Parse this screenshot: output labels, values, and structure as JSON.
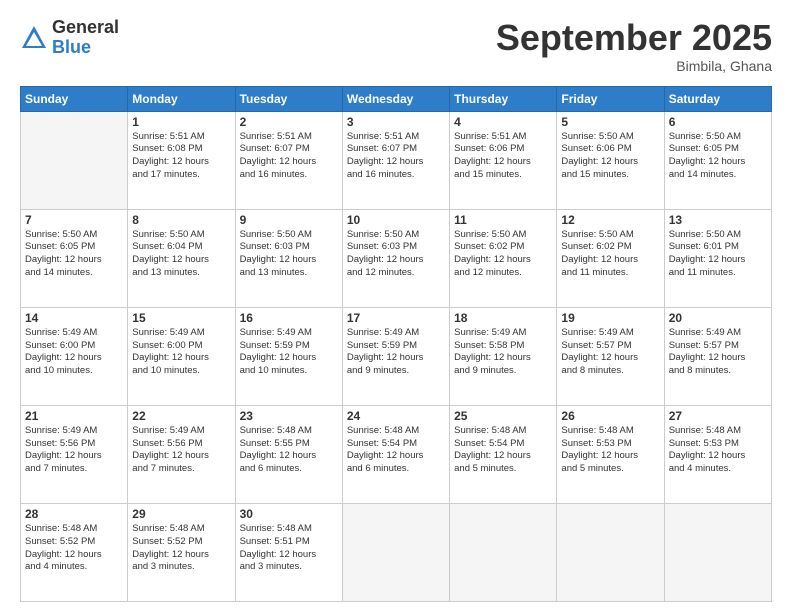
{
  "header": {
    "logo_general": "General",
    "logo_blue": "Blue",
    "month": "September 2025",
    "location": "Bimbila, Ghana"
  },
  "days_of_week": [
    "Sunday",
    "Monday",
    "Tuesday",
    "Wednesday",
    "Thursday",
    "Friday",
    "Saturday"
  ],
  "weeks": [
    [
      {
        "day": "",
        "info": ""
      },
      {
        "day": "1",
        "info": "Sunrise: 5:51 AM\nSunset: 6:08 PM\nDaylight: 12 hours\nand 17 minutes."
      },
      {
        "day": "2",
        "info": "Sunrise: 5:51 AM\nSunset: 6:07 PM\nDaylight: 12 hours\nand 16 minutes."
      },
      {
        "day": "3",
        "info": "Sunrise: 5:51 AM\nSunset: 6:07 PM\nDaylight: 12 hours\nand 16 minutes."
      },
      {
        "day": "4",
        "info": "Sunrise: 5:51 AM\nSunset: 6:06 PM\nDaylight: 12 hours\nand 15 minutes."
      },
      {
        "day": "5",
        "info": "Sunrise: 5:50 AM\nSunset: 6:06 PM\nDaylight: 12 hours\nand 15 minutes."
      },
      {
        "day": "6",
        "info": "Sunrise: 5:50 AM\nSunset: 6:05 PM\nDaylight: 12 hours\nand 14 minutes."
      }
    ],
    [
      {
        "day": "7",
        "info": "Sunrise: 5:50 AM\nSunset: 6:05 PM\nDaylight: 12 hours\nand 14 minutes."
      },
      {
        "day": "8",
        "info": "Sunrise: 5:50 AM\nSunset: 6:04 PM\nDaylight: 12 hours\nand 13 minutes."
      },
      {
        "day": "9",
        "info": "Sunrise: 5:50 AM\nSunset: 6:03 PM\nDaylight: 12 hours\nand 13 minutes."
      },
      {
        "day": "10",
        "info": "Sunrise: 5:50 AM\nSunset: 6:03 PM\nDaylight: 12 hours\nand 12 minutes."
      },
      {
        "day": "11",
        "info": "Sunrise: 5:50 AM\nSunset: 6:02 PM\nDaylight: 12 hours\nand 12 minutes."
      },
      {
        "day": "12",
        "info": "Sunrise: 5:50 AM\nSunset: 6:02 PM\nDaylight: 12 hours\nand 11 minutes."
      },
      {
        "day": "13",
        "info": "Sunrise: 5:50 AM\nSunset: 6:01 PM\nDaylight: 12 hours\nand 11 minutes."
      }
    ],
    [
      {
        "day": "14",
        "info": "Sunrise: 5:49 AM\nSunset: 6:00 PM\nDaylight: 12 hours\nand 10 minutes."
      },
      {
        "day": "15",
        "info": "Sunrise: 5:49 AM\nSunset: 6:00 PM\nDaylight: 12 hours\nand 10 minutes."
      },
      {
        "day": "16",
        "info": "Sunrise: 5:49 AM\nSunset: 5:59 PM\nDaylight: 12 hours\nand 10 minutes."
      },
      {
        "day": "17",
        "info": "Sunrise: 5:49 AM\nSunset: 5:59 PM\nDaylight: 12 hours\nand 9 minutes."
      },
      {
        "day": "18",
        "info": "Sunrise: 5:49 AM\nSunset: 5:58 PM\nDaylight: 12 hours\nand 9 minutes."
      },
      {
        "day": "19",
        "info": "Sunrise: 5:49 AM\nSunset: 5:57 PM\nDaylight: 12 hours\nand 8 minutes."
      },
      {
        "day": "20",
        "info": "Sunrise: 5:49 AM\nSunset: 5:57 PM\nDaylight: 12 hours\nand 8 minutes."
      }
    ],
    [
      {
        "day": "21",
        "info": "Sunrise: 5:49 AM\nSunset: 5:56 PM\nDaylight: 12 hours\nand 7 minutes."
      },
      {
        "day": "22",
        "info": "Sunrise: 5:49 AM\nSunset: 5:56 PM\nDaylight: 12 hours\nand 7 minutes."
      },
      {
        "day": "23",
        "info": "Sunrise: 5:48 AM\nSunset: 5:55 PM\nDaylight: 12 hours\nand 6 minutes."
      },
      {
        "day": "24",
        "info": "Sunrise: 5:48 AM\nSunset: 5:54 PM\nDaylight: 12 hours\nand 6 minutes."
      },
      {
        "day": "25",
        "info": "Sunrise: 5:48 AM\nSunset: 5:54 PM\nDaylight: 12 hours\nand 5 minutes."
      },
      {
        "day": "26",
        "info": "Sunrise: 5:48 AM\nSunset: 5:53 PM\nDaylight: 12 hours\nand 5 minutes."
      },
      {
        "day": "27",
        "info": "Sunrise: 5:48 AM\nSunset: 5:53 PM\nDaylight: 12 hours\nand 4 minutes."
      }
    ],
    [
      {
        "day": "28",
        "info": "Sunrise: 5:48 AM\nSunset: 5:52 PM\nDaylight: 12 hours\nand 4 minutes."
      },
      {
        "day": "29",
        "info": "Sunrise: 5:48 AM\nSunset: 5:52 PM\nDaylight: 12 hours\nand 3 minutes."
      },
      {
        "day": "30",
        "info": "Sunrise: 5:48 AM\nSunset: 5:51 PM\nDaylight: 12 hours\nand 3 minutes."
      },
      {
        "day": "",
        "info": ""
      },
      {
        "day": "",
        "info": ""
      },
      {
        "day": "",
        "info": ""
      },
      {
        "day": "",
        "info": ""
      }
    ]
  ]
}
